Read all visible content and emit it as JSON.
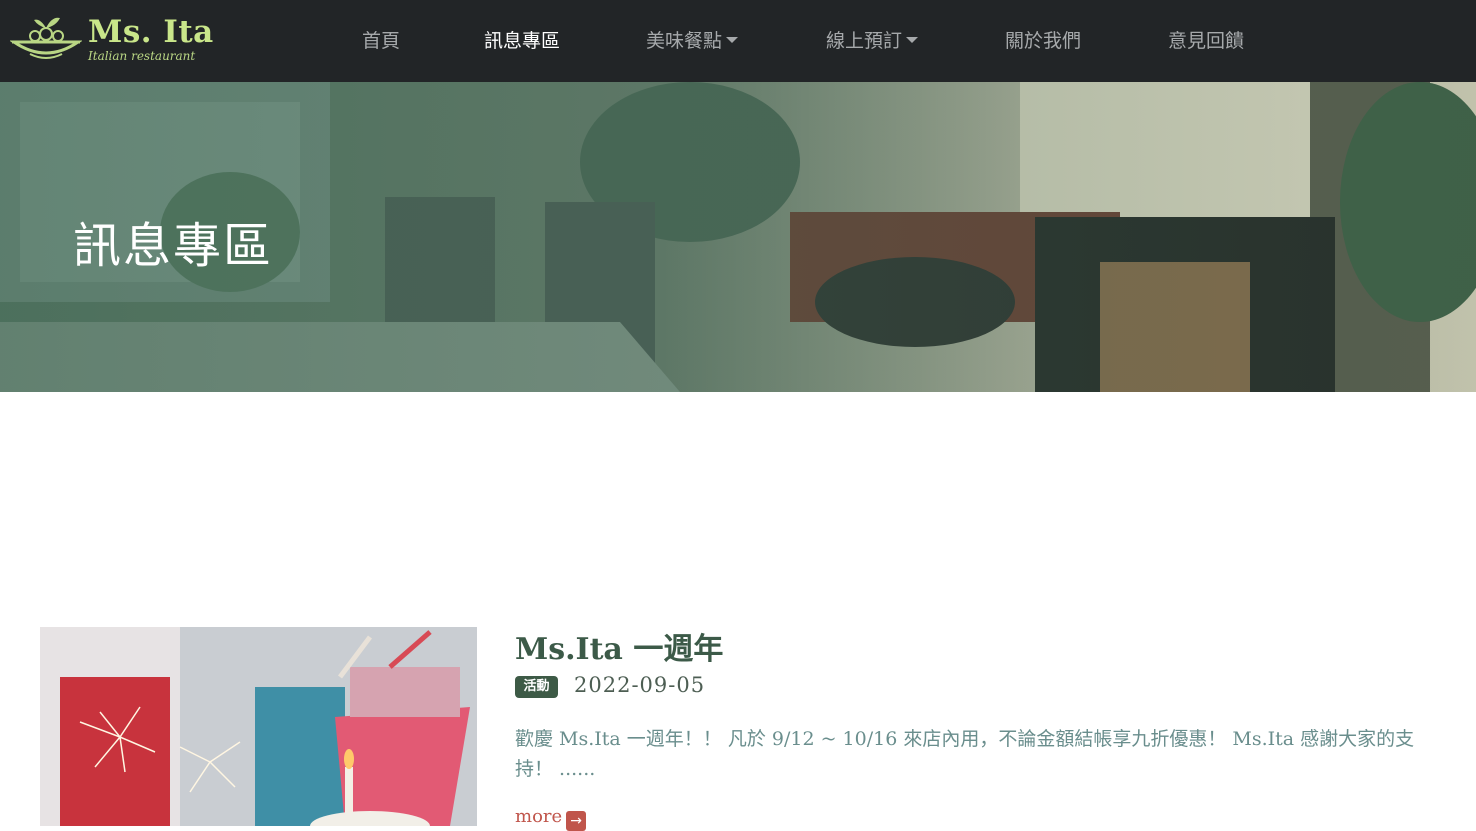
{
  "brand": {
    "name": "Ms. Ita",
    "subtitle": "Italian restaurant"
  },
  "nav": {
    "home": "首頁",
    "news": "訊息專區",
    "menu": "美味餐點",
    "booking": "線上預訂",
    "about": "關於我們",
    "feedback": "意見回饋"
  },
  "hero": {
    "title": "訊息專區"
  },
  "article": {
    "title": "Ms.Ita 一週年",
    "tag": "活動",
    "date": "2022-09-05",
    "excerpt": "歡慶 Ms.Ita 一週年！！ 凡於 9/12 ~ 10/16 來店內用，不論金額結帳享九折優惠！ Ms.Ita 感謝大家的支持！ ......",
    "more": "more",
    "more_icon": "arrow-right-icon"
  },
  "colors": {
    "nav_bg": "#222527",
    "brand_green": "#c9e68a",
    "accent_green": "#3d5a46",
    "link_red": "#c0554b",
    "excerpt_teal": "#6a8e8d"
  }
}
